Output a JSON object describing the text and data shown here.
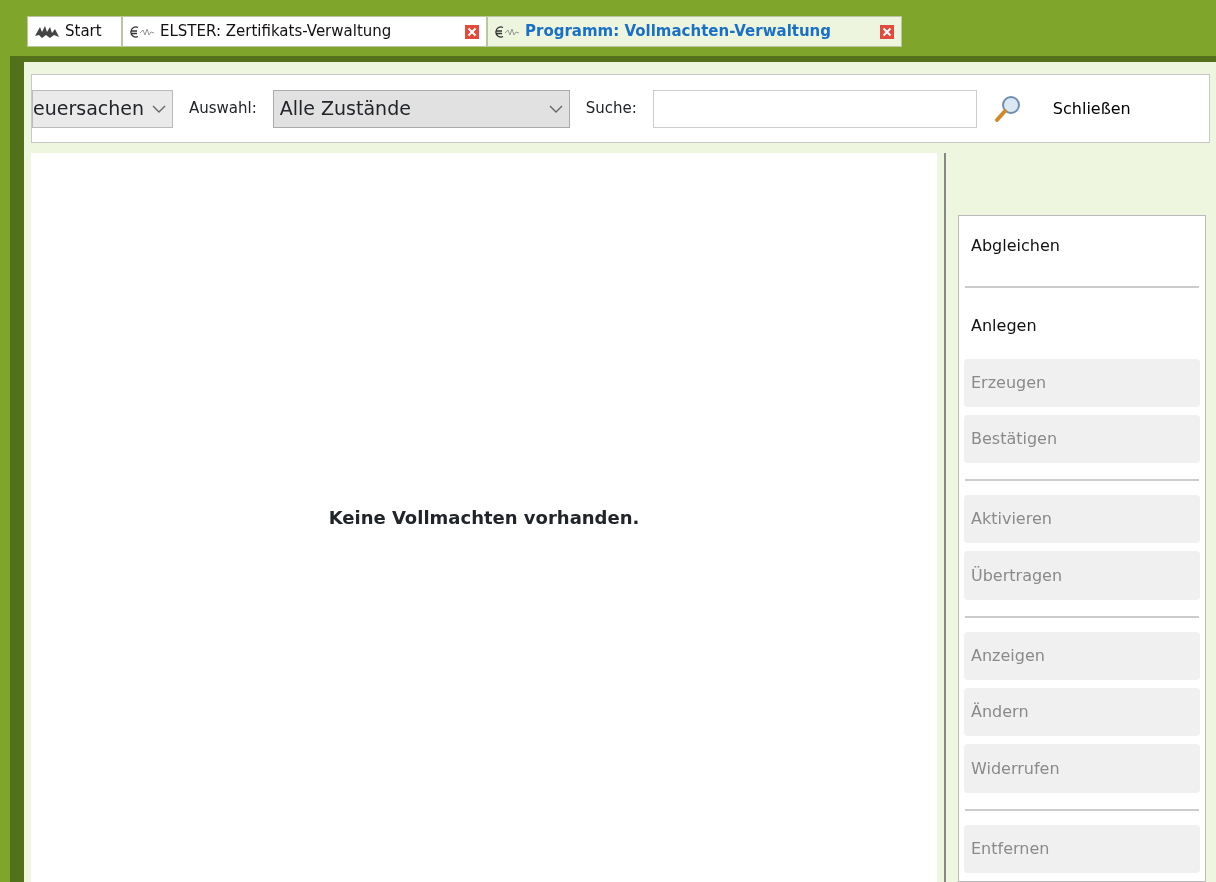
{
  "tabs": [
    {
      "label": "Start",
      "kind": "start",
      "closable": false,
      "selected": false
    },
    {
      "label": "ELSTER: Zertifikats-Verwaltung",
      "kind": "euro",
      "closable": true,
      "selected": false
    },
    {
      "label": "Programm: Vollmachten-Verwaltung",
      "kind": "euro",
      "closable": true,
      "selected": true
    }
  ],
  "toolbar": {
    "category_select": "euersachen",
    "filter_label": "Auswahl:",
    "filter_select": "Alle Zustände",
    "search_label": "Suche:",
    "close_button": "Schließen"
  },
  "empty_message": "Keine Vollmachten vorhanden.",
  "action_groups": [
    [
      {
        "label": "Abgleichen",
        "disabled": false
      }
    ],
    [
      {
        "label": "Anlegen",
        "disabled": false
      },
      {
        "label": "Erzeugen",
        "disabled": true
      },
      {
        "label": "Bestätigen",
        "disabled": true
      }
    ],
    [
      {
        "label": "Aktivieren",
        "disabled": true
      },
      {
        "label": "Übertragen",
        "disabled": true
      }
    ],
    [
      {
        "label": "Anzeigen",
        "disabled": true
      },
      {
        "label": "Ändern",
        "disabled": true
      },
      {
        "label": "Widerrufen",
        "disabled": true
      }
    ],
    [
      {
        "label": "Entfernen",
        "disabled": true
      }
    ]
  ]
}
